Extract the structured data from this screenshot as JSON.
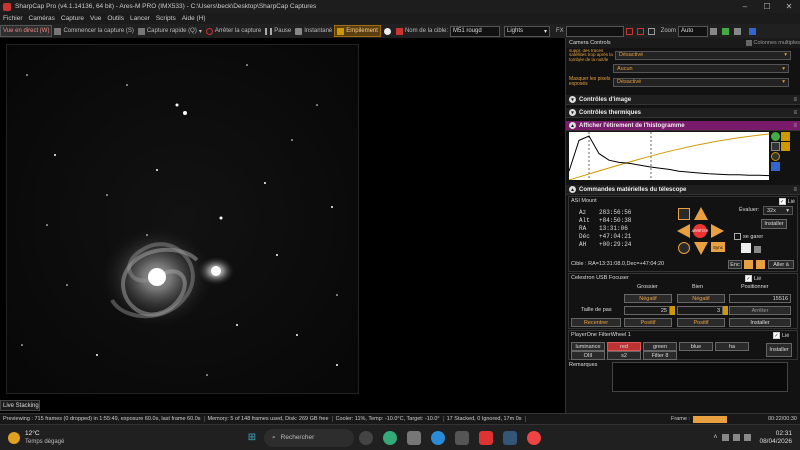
{
  "window": {
    "title": "SharpCap Pro (v4.1.14136, 64 bit) - Ares-M PRO (IMX533) - C:\\Users\\beck\\Desktop\\SharpCap Captures"
  },
  "menu": [
    "Fichier",
    "Caméras",
    "Capture",
    "Vue",
    "Outils",
    "Lancer",
    "Scripts",
    "Aide (H)"
  ],
  "toolbar": {
    "live": "Vue en direct (W)",
    "start_capture": "Commencer la capture (S)",
    "quick_capture": "Capture rapide (Q)",
    "stop_capture": "Arrêter la capture",
    "pause": "Pause",
    "snapshot": "Instantané",
    "stacking": "Empilement",
    "target_label": "Nom de la cible:",
    "target_value": "M51 rougd",
    "frame_type": "Lights",
    "fx_label": "FX",
    "zoom_label": "Zoom",
    "zoom_value": "Auto"
  },
  "live_stacking_label": "Live Stacking",
  "panel": {
    "camera_controls": "Camera Controls",
    "multi_columns": "Colonnes multiples",
    "row1_label": "suppr. des traces satellites trop après la tombée de la nuit/le réveil",
    "row1_value": "Désactivé",
    "row2_value": "Aucun",
    "row3_label": "Masquer les pixels exposés",
    "row3_value": "Désactivé",
    "image_controls": "Contrôles d'image",
    "thermal_controls": "Contrôles thermiques",
    "histogram_title": "Afficher l'étirement de l'histogramme",
    "telescope_title": "Commandes matérielles du télescope",
    "mount": {
      "name": "ASI Mount",
      "lie": "Lié",
      "az_label": "Az",
      "az": "283:56:56",
      "alt_label": "Alt",
      "alt": "+84:50:38",
      "ra_label": "RA",
      "ra": "13:31:06",
      "dec_label": "Déc",
      "dec": "+47:04:21",
      "ah_label": "AH",
      "ah": "+00:29:24",
      "evaluate_label": "Évaluer:",
      "evaluate_value": "32x",
      "install": "Installer",
      "park": "se garer",
      "stop": "ARRÊTER",
      "sync": "Sync",
      "target": "Cible : RA=13:31:08.0,Dec=+47:04:20",
      "enc": "Enc",
      "goto": "Aller à"
    },
    "focuser": {
      "name": "Celestron USB Focuser",
      "lie": "Lié",
      "coarse": "Grossier",
      "fine": "Bien",
      "position": "Positionner",
      "neg1": "Négatif",
      "neg2": "Négatif",
      "position_value": "15516",
      "step_label": "Taille de pas",
      "step1": "25",
      "step2": "3",
      "stop": "Arrêter",
      "back": "Recentrer",
      "pos1": "Positif",
      "pos2": "Positif",
      "install": "Installer"
    },
    "filterwheel": {
      "name": "PlayerOne FilterWheel 1",
      "lie": "Lié",
      "filters": [
        "luminance",
        "red",
        "green",
        "blue",
        "ha",
        "OIII",
        "s2",
        "Filter 8"
      ],
      "install": "Installer"
    },
    "remarks": "Remarques"
  },
  "status": {
    "preview": "Previewing : 715 frames (0 dropped) in 1:55:49, exposure 60.0s, last frame 60.0s",
    "memory": "Memory: 5 of 148 frames used, Disk: 269 GB free",
    "cooler": "Cooler: 11%, Temp: -10.0°C, Target: -10.0°",
    "stacked": "17 Stacked, 0 Ignored, 17m 0s",
    "frame": "Frame :",
    "time": "00:22/00:30"
  },
  "taskbar": {
    "weather_temp": "12°C",
    "weather_desc": "Temps dégagé",
    "search": "Rechercher",
    "clock_time": "02:31",
    "clock_date": "08/04/2026"
  },
  "histogram_data": {
    "type": "line",
    "x": [
      0,
      5,
      10,
      15,
      20,
      25,
      30,
      35,
      40,
      45,
      50,
      55,
      60,
      65,
      70,
      75,
      80,
      85,
      90,
      95,
      100
    ],
    "values": [
      20,
      90,
      100,
      60,
      45,
      40,
      38,
      34,
      30,
      27,
      24,
      20,
      18,
      16,
      14,
      13,
      12,
      12,
      11,
      11,
      10
    ]
  }
}
